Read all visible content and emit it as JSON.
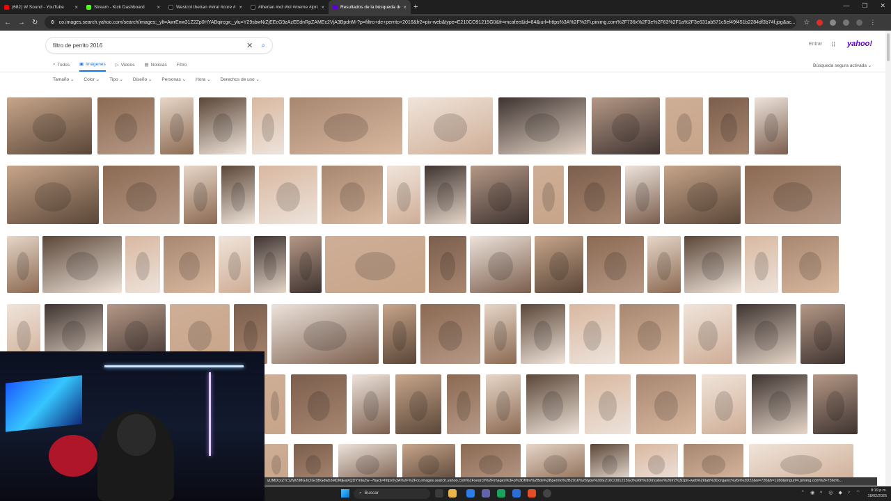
{
  "browser": {
    "tabs": [
      {
        "label": "(682) W Sound - YouTube",
        "color": "#ff0000",
        "active": false
      },
      {
        "label": "Stream - Kick Dashboard",
        "color": "#53fc18",
        "active": false
      },
      {
        "label": "Westcol therian #viral #core #...",
        "color": "#111111",
        "active": false
      },
      {
        "label": "#therian #xd #lol #meme #jordi...",
        "color": "#111111",
        "active": false
      },
      {
        "label": "Resultados de la búsqueda de ...",
        "color": "#6001d2",
        "active": true
      }
    ],
    "url": "co.images.search.yahoo.com/search/images;_ylt=AwrEnw31Z2Zp0HYABqircgx;_ylu=Y29sbwNiZjEEcG9zAzEEdnRpZAMEc2VjA3BpdnM-?p=filtro+de+perrito+2016&fr2=piv-web&type=E210CO91215G0&fr=mcafee&id=84&iurl=https%3A%2F%2Fi.pinimg.com%2F736x%2F3e%2F63%2F1a%2F3e631ab571c5ef49f451b2284df3b74f.jpg&ac..."
  },
  "search": {
    "query": "filtro de perrito 2016",
    "signin": "Entrar",
    "logo": "yahoo!"
  },
  "nav": {
    "tabs": [
      "Todos",
      "Imágenes",
      "Videos",
      "Noticias",
      "Filtro"
    ],
    "safe_search": "Búsqueda segura activada"
  },
  "filters": [
    "Tamaño",
    "Color",
    "Tipo",
    "Diseño",
    "Personas",
    "Hora",
    "Derechos de uso"
  ],
  "status_url": "ylJMDcxZTc1ZWZlMGJkZGI3BGdwb3MDMjEaXQDYmluZw--?back=https%3A%2F%2Fco.images.search.yahoo.com%2Fsearch%2Fimages%3Fp%3Dfiltro%2Bde%2Bperrito%2B2016%26type%3DE210CO91215G0%26fr%3Dmcafee%26fr2%3Dpiv-web%26tab%3Dorganic%26ri%3D22&w=720&h=1280&imgurl=i.pinimg.com%2F736x%...",
  "taskbar": {
    "search_label": "Buscar",
    "time": "8:19 p.m.",
    "date": "18/02/2026"
  }
}
